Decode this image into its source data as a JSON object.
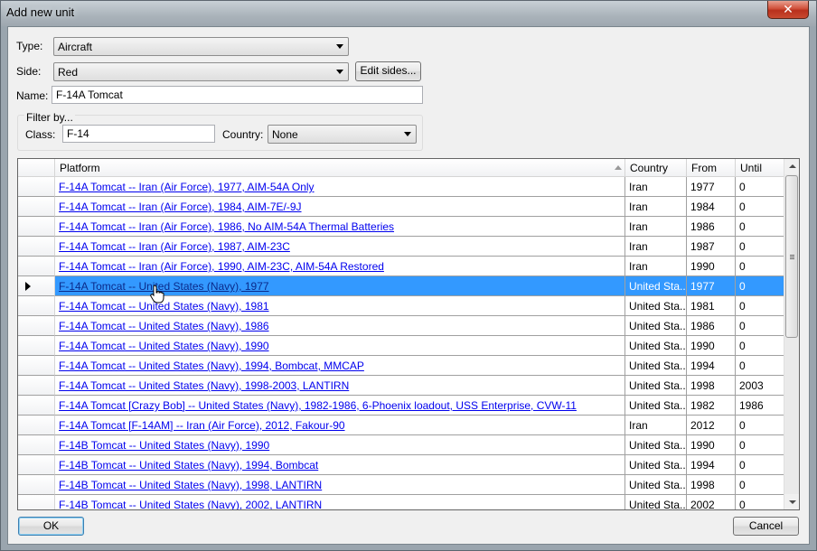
{
  "window": {
    "title": "Add new unit",
    "close_glyph": "✕"
  },
  "form": {
    "type_label": "Type:",
    "type_value": "Aircraft",
    "side_label": "Side:",
    "side_value": "Red",
    "edit_sides_label": "Edit sides...",
    "name_label": "Name:",
    "name_value": "F-14A Tomcat",
    "filter_title": "Filter by...",
    "class_label": "Class:",
    "class_value": "F-14",
    "country_label": "Country:",
    "country_value": "None"
  },
  "grid": {
    "columns": [
      "Platform",
      "Country",
      "From",
      "Until"
    ],
    "selected_index": 5,
    "rows": [
      {
        "platform": "F-14A Tomcat -- Iran (Air Force), 1977, AIM-54A Only",
        "country": "Iran",
        "from": "1977",
        "until": "0"
      },
      {
        "platform": "F-14A Tomcat -- Iran (Air Force), 1984, AIM-7E/-9J",
        "country": "Iran",
        "from": "1984",
        "until": "0"
      },
      {
        "platform": "F-14A Tomcat -- Iran (Air Force), 1986, No AIM-54A Thermal Batteries",
        "country": "Iran",
        "from": "1986",
        "until": "0"
      },
      {
        "platform": "F-14A Tomcat -- Iran (Air Force), 1987, AIM-23C",
        "country": "Iran",
        "from": "1987",
        "until": "0"
      },
      {
        "platform": "F-14A Tomcat -- Iran (Air Force), 1990, AIM-23C, AIM-54A Restored",
        "country": "Iran",
        "from": "1990",
        "until": "0"
      },
      {
        "platform": "F-14A Tomcat -- United States (Navy), 1977",
        "country": "United Sta...",
        "from": "1977",
        "until": "0"
      },
      {
        "platform": "F-14A Tomcat -- United States (Navy), 1981",
        "country": "United Sta...",
        "from": "1981",
        "until": "0"
      },
      {
        "platform": "F-14A Tomcat -- United States (Navy), 1986",
        "country": "United Sta...",
        "from": "1986",
        "until": "0"
      },
      {
        "platform": "F-14A Tomcat -- United States (Navy), 1990",
        "country": "United Sta...",
        "from": "1990",
        "until": "0"
      },
      {
        "platform": "F-14A Tomcat -- United States (Navy), 1994, Bombcat, MMCAP",
        "country": "United Sta...",
        "from": "1994",
        "until": "0"
      },
      {
        "platform": "F-14A Tomcat -- United States (Navy), 1998-2003, LANTIRN",
        "country": "United Sta...",
        "from": "1998",
        "until": "2003"
      },
      {
        "platform": "F-14A Tomcat [Crazy Bob] -- United States (Navy), 1982-1986, 6-Phoenix loadout, USS Enterprise, CVW-11",
        "country": "United Sta...",
        "from": "1982",
        "until": "1986"
      },
      {
        "platform": "F-14A Tomcat [F-14AM] -- Iran (Air Force), 2012, Fakour-90",
        "country": "Iran",
        "from": "2012",
        "until": "0"
      },
      {
        "platform": "F-14B Tomcat -- United States (Navy), 1990",
        "country": "United Sta...",
        "from": "1990",
        "until": "0"
      },
      {
        "platform": "F-14B Tomcat -- United States (Navy), 1994, Bombcat",
        "country": "United Sta...",
        "from": "1994",
        "until": "0"
      },
      {
        "platform": "F-14B Tomcat -- United States (Navy), 1998, LANTIRN",
        "country": "United Sta...",
        "from": "1998",
        "until": "0"
      },
      {
        "platform": "F-14B Tomcat -- United States (Navy), 2002, LANTIRN",
        "country": "United Sta...",
        "from": "2002",
        "until": "0"
      }
    ]
  },
  "buttons": {
    "ok": "OK",
    "cancel": "Cancel"
  },
  "icons": {
    "close": "close-icon",
    "dropdown": "chevron-down-icon",
    "sort": "sort-ascending-icon",
    "row_selector": "row-pointer-icon",
    "cursor": "hand-cursor-icon"
  }
}
